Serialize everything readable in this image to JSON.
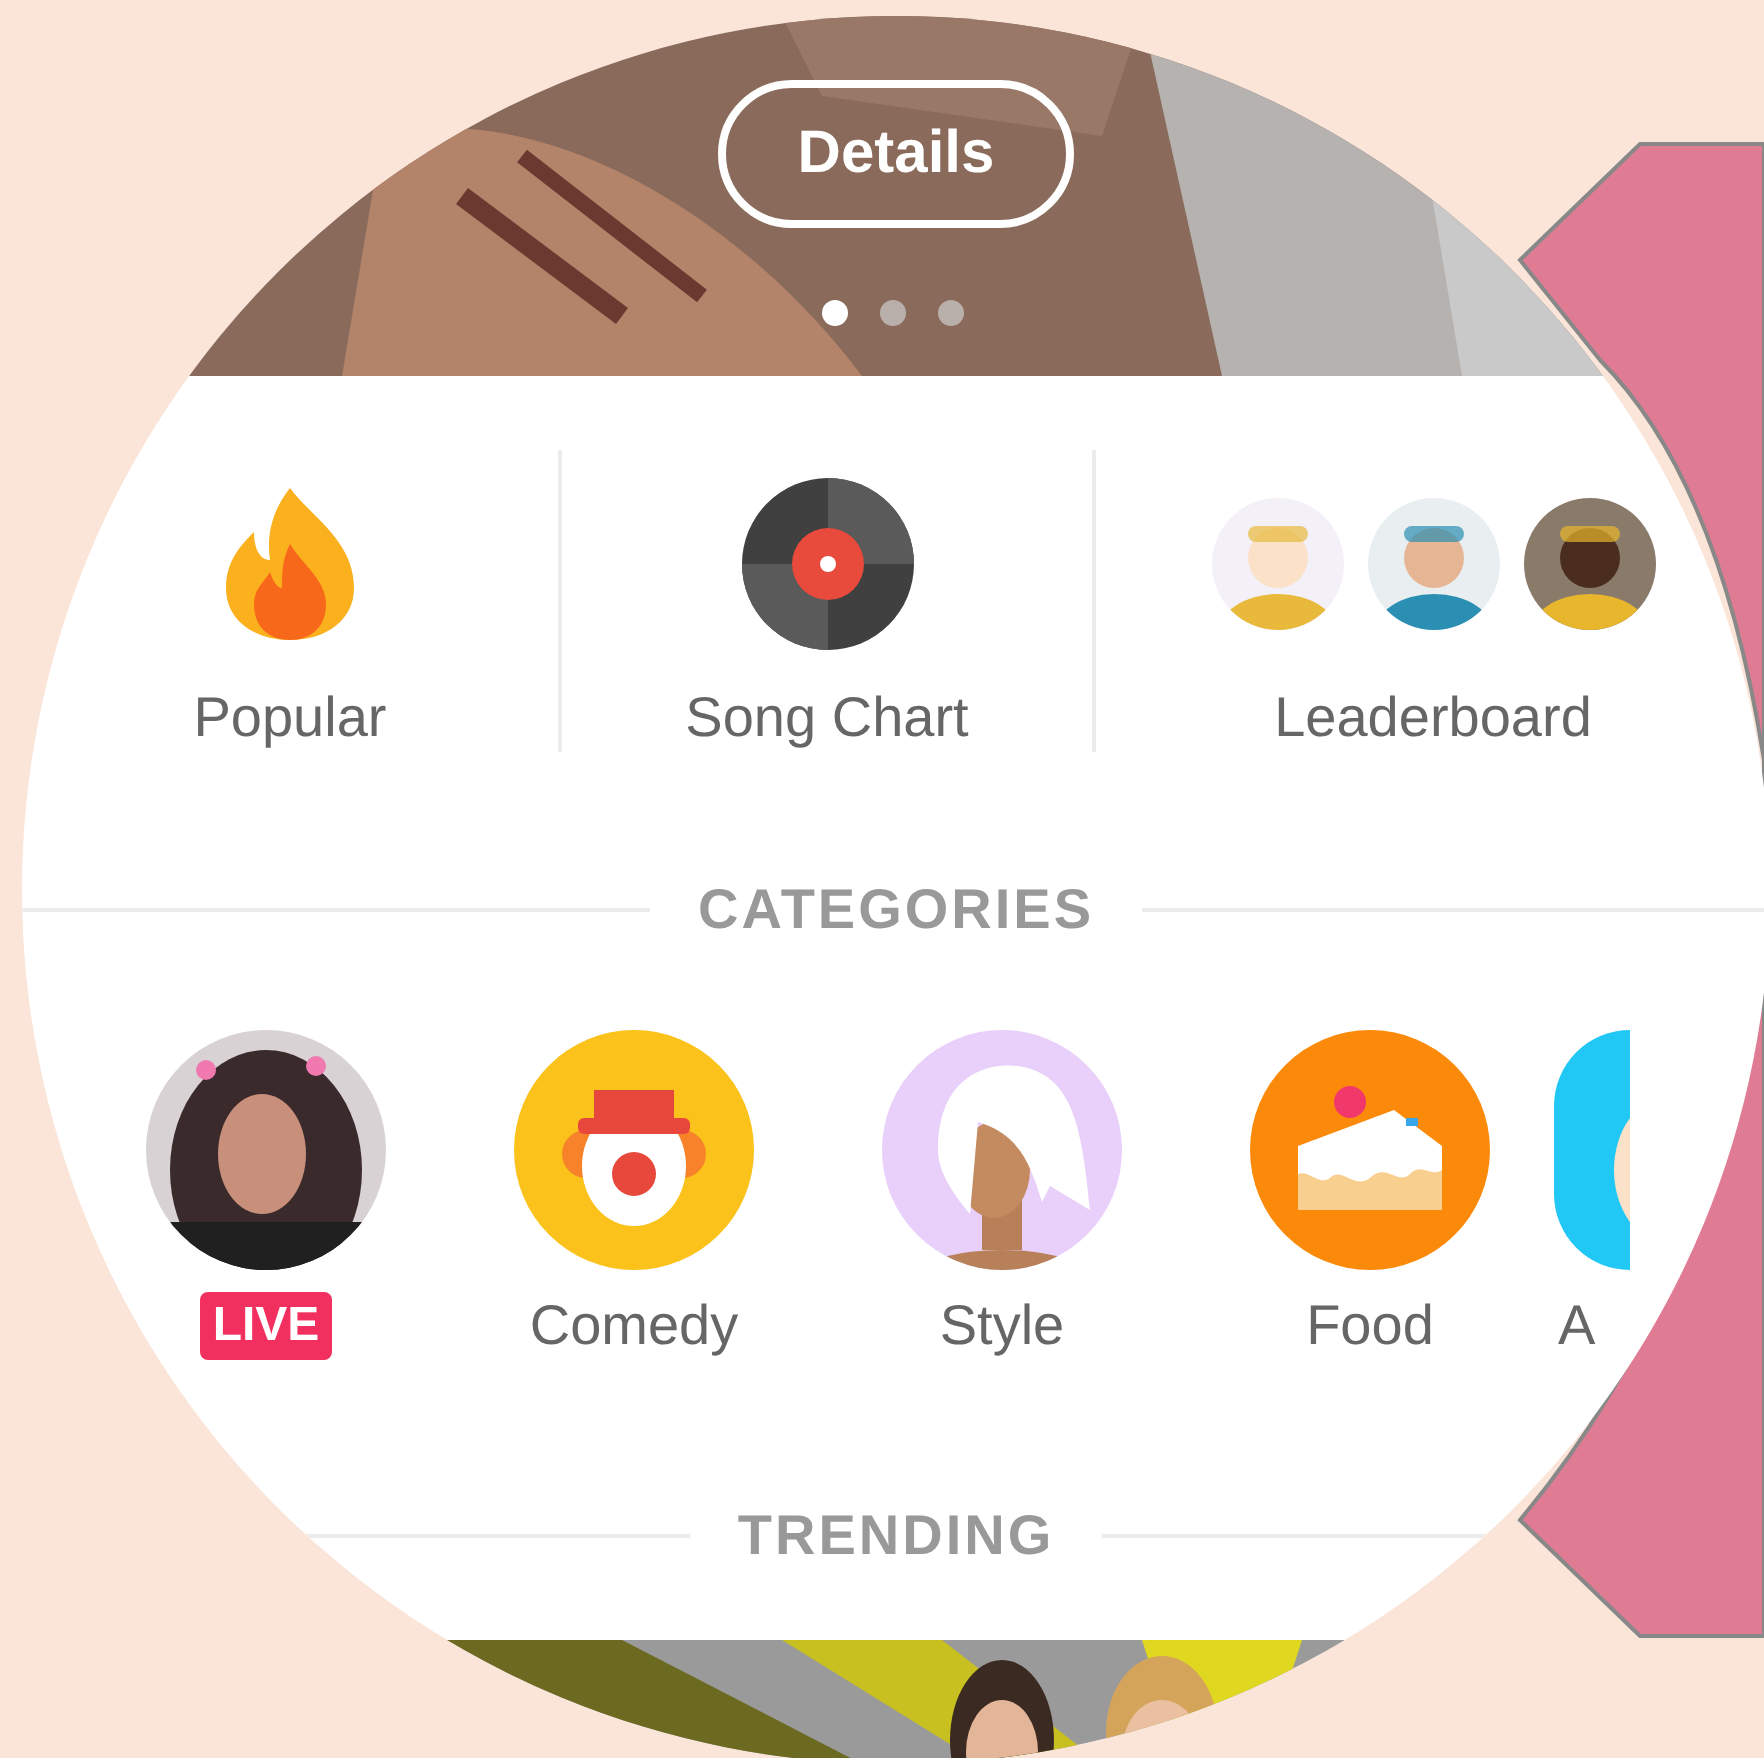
{
  "banner": {
    "button": "Details",
    "dots": [
      {
        "selected": true
      },
      {
        "selected": false
      },
      {
        "selected": false
      }
    ]
  },
  "shortcuts": [
    {
      "kind": "fire",
      "label": "Popular"
    },
    {
      "kind": "record",
      "label": "Song Chart"
    },
    {
      "kind": "avatars",
      "label": "Leaderboard"
    }
  ],
  "categories_heading": "CATEGORIES",
  "categories": [
    {
      "kind": "live",
      "badge": "LIVE"
    },
    {
      "kind": "clown",
      "label": "Comedy",
      "color": "#fbc21b"
    },
    {
      "kind": "hair",
      "label": "Style",
      "color": "#e8d0fa"
    },
    {
      "kind": "cake",
      "label": "Food",
      "color": "#fb8a0b"
    },
    {
      "kind": "face",
      "label": "A",
      "color": "#22c8f5"
    }
  ],
  "trending_heading": "TRENDING"
}
